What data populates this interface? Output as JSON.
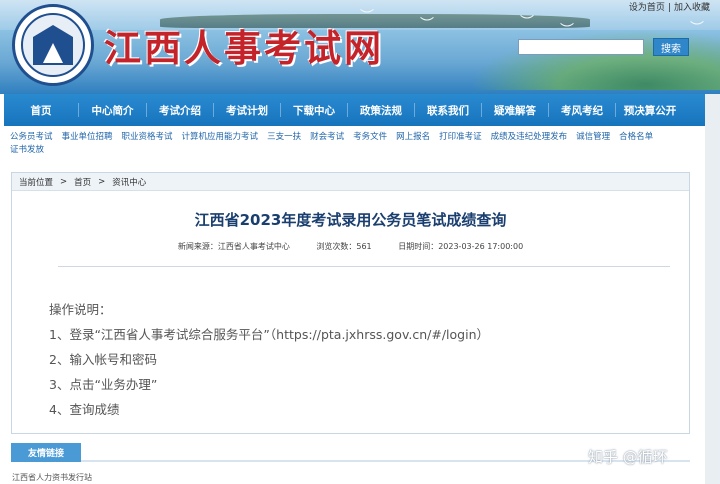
{
  "header": {
    "site_title": "江西人事考试网",
    "top_links": [
      "设为首页",
      "加入收藏"
    ],
    "top_link_sep": "|",
    "search": {
      "placeholder": "",
      "button_label": "搜索"
    }
  },
  "nav": {
    "items": [
      "首页",
      "中心简介",
      "考试介绍",
      "考试计划",
      "下载中心",
      "政策法规",
      "联系我们",
      "疑难解答",
      "考风考纪",
      "预决算公开"
    ]
  },
  "subnav": {
    "items": [
      "公务员考试",
      "事业单位招聘",
      "职业资格考试",
      "计算机应用能力考试",
      "三支一扶",
      "财会考试",
      "考务文件",
      "网上报名",
      "打印准考证",
      "成绩及违纪处理发布",
      "诚信管理",
      "合格名单",
      "证书发放"
    ]
  },
  "breadcrumb": {
    "label": "当前位置",
    "items": [
      "首页",
      "资讯中心"
    ],
    "separator": ">"
  },
  "article": {
    "title": "江西省2023年度考试录用公务员笔试成绩查询",
    "meta_source": "新闻来源：江西省人事考试中心",
    "meta_views": "浏览次数：561",
    "meta_date": "日期时间：2023-03-26 17:00:00",
    "lines": [
      "操作说明：",
      "1、登录“江西省人事考试综合服务平台”（https://pta.jxhrss.gov.cn/#/login）",
      "2、输入帐号和密码",
      "3、点击“业务办理”",
      "4、查询成绩"
    ]
  },
  "footer": {
    "links_tab": "友情链接",
    "first_link": "江西省人力资书发行站"
  },
  "watermark": "知乎 @循环",
  "colors": {
    "nav_bg": "#1f80c8",
    "title_red": "#c4232a",
    "article_title": "#1a3f6f",
    "link_blue": "#2266aa"
  }
}
